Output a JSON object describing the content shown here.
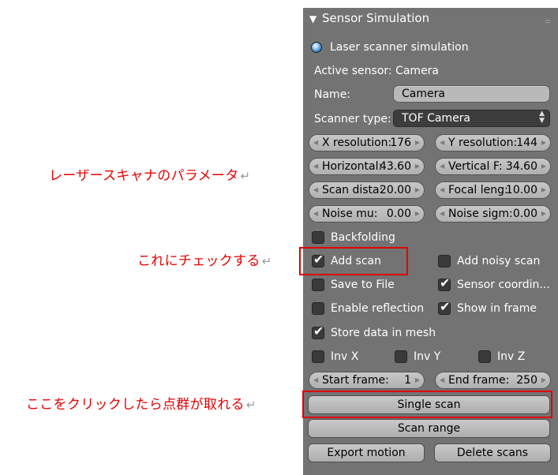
{
  "annotations": {
    "laser_params": "レーザースキャナのパラメータ",
    "check_this": "これにチェックする",
    "click_here": "ここをクリックしたら点群が取れる",
    "return_mark": "↵"
  },
  "panel": {
    "title": "Sensor Simulation",
    "collapse_glyph": "▼",
    "grip_glyph": "::::",
    "laser_label": "Laser scanner simulation",
    "active_sensor": "Active sensor: Camera",
    "name_label": "Name:",
    "name_value": "Camera",
    "scanner_type_label": "Scanner type:",
    "scanner_type_value": "TOF Camera",
    "fields": {
      "x_res": {
        "label": "X resolution:",
        "value": "176"
      },
      "y_res": {
        "label": "Y resolution:",
        "value": "144"
      },
      "horiz": {
        "label": "Horizontal:",
        "value": "43.60"
      },
      "vert": {
        "label": "Vertical F:",
        "value": "34.60"
      },
      "scan_d": {
        "label": "Scan dista:",
        "value": "20.00"
      },
      "focal": {
        "label": "Focal leng:",
        "value": "10.00"
      },
      "noise_mu": {
        "label": "Noise mu:",
        "value": "0.00"
      },
      "noise_s": {
        "label": "Noise sigm:",
        "value": "0.00"
      },
      "start_f": {
        "label": "Start frame:",
        "value": "1"
      },
      "end_f": {
        "label": "End frame:",
        "value": "250"
      }
    },
    "checkboxes": {
      "backfolding": {
        "label": "Backfolding",
        "checked": false
      },
      "add_scan": {
        "label": "Add scan",
        "checked": true
      },
      "add_noisy_scan": {
        "label": "Add noisy scan",
        "checked": false
      },
      "save_to_file": {
        "label": "Save to File",
        "checked": false
      },
      "sensor_coord": {
        "label": "Sensor coordin...",
        "checked": true
      },
      "enable_refl": {
        "label": "Enable reflection",
        "checked": false
      },
      "show_in_frame": {
        "label": "Show in frame",
        "checked": true
      },
      "store_mesh": {
        "label": "Store data in mesh",
        "checked": true
      },
      "inv_x": {
        "label": "Inv X",
        "checked": false
      },
      "inv_y": {
        "label": "Inv Y",
        "checked": false
      },
      "inv_z": {
        "label": "Inv Z",
        "checked": false
      }
    },
    "buttons": {
      "single_scan": "Single scan",
      "scan_range": "Scan range",
      "export_motion": "Export motion",
      "delete_scans": "Delete scans"
    },
    "glyphs": {
      "check": "✔",
      "arrow_left": "◀",
      "arrow_right": "▶",
      "up": "▲",
      "down": "▼"
    }
  },
  "colors": {
    "panel_bg": "#737373",
    "annotation_red": "#e60000"
  }
}
